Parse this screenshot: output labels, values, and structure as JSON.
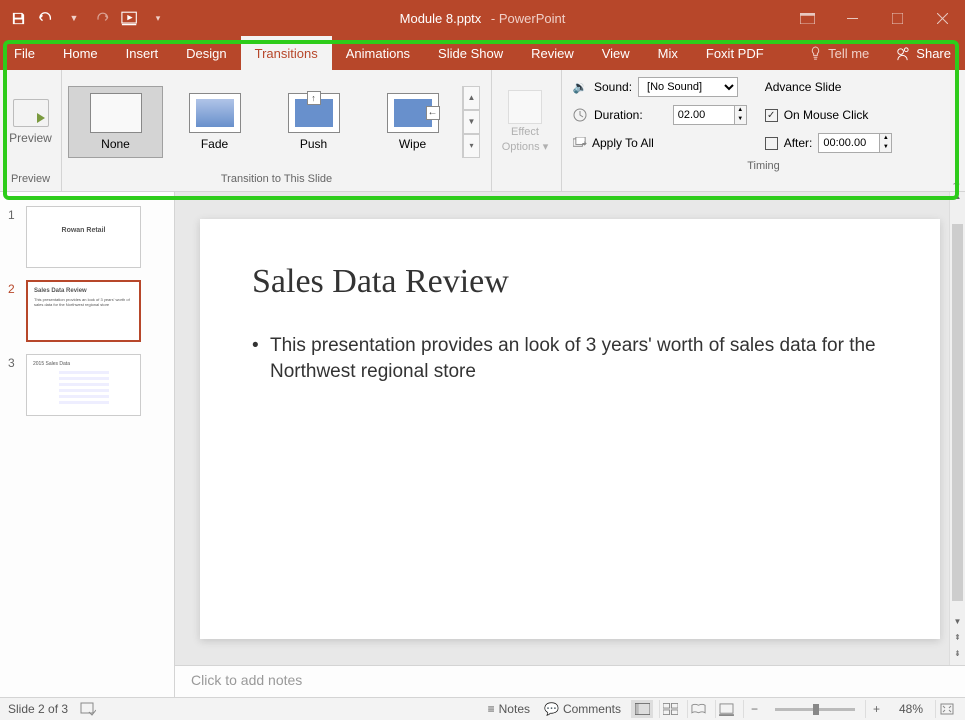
{
  "title": {
    "doc": "Module 8.pptx",
    "app": "PowerPoint"
  },
  "menu": {
    "file": "File",
    "home": "Home",
    "insert": "Insert",
    "design": "Design",
    "transitions": "Transitions",
    "animations": "Animations",
    "slideshow": "Slide Show",
    "review": "Review",
    "view": "View",
    "mix": "Mix",
    "foxit": "Foxit PDF",
    "tellme": "Tell me",
    "share": "Share"
  },
  "ribbon": {
    "preview_label": "Preview",
    "preview_group": "Preview",
    "transitions": {
      "none": "None",
      "fade": "Fade",
      "push": "Push",
      "wipe": "Wipe"
    },
    "trans_group": "Transition to This Slide",
    "effect_top": "Effect",
    "effect_bottom": "Options",
    "timing": {
      "sound": "Sound:",
      "sound_val": "[No Sound]",
      "duration": "Duration:",
      "duration_val": "02.00",
      "apply_all": "Apply To All",
      "advance": "Advance Slide",
      "on_click": "On Mouse Click",
      "after": "After:",
      "after_val": "00:00.00",
      "group": "Timing"
    }
  },
  "slides": {
    "s1": {
      "num": "1",
      "title": "Rowan Retail"
    },
    "s2": {
      "num": "2",
      "title": "Sales Data Review",
      "body": "This presentation provides an look of 3 years' worth of sales data for the Northwest regional store"
    },
    "s3": {
      "num": "3",
      "title": "2015 Sales Data"
    }
  },
  "slide_content": {
    "title": "Sales Data Review",
    "bullet": "This presentation provides an look of 3 years' worth of sales data for the Northwest regional store"
  },
  "notes_placeholder": "Click to add notes",
  "status": {
    "slide": "Slide 2 of 3",
    "notes": "Notes",
    "comments": "Comments",
    "zoom": "48%"
  }
}
